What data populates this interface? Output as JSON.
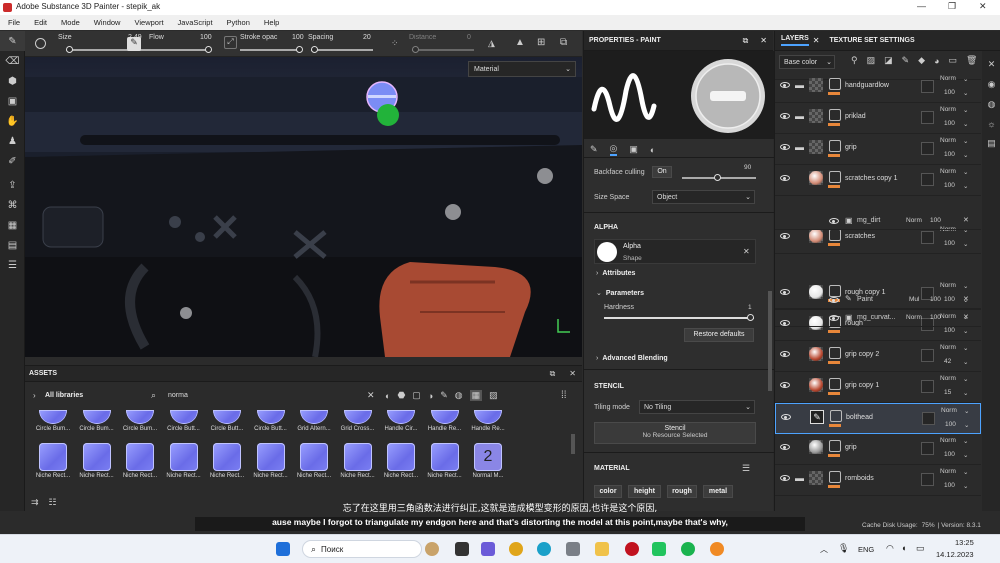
{
  "window": {
    "title": "Adobe Substance 3D Painter - stepik_ak"
  },
  "menu": [
    "File",
    "Edit",
    "Mode",
    "Window",
    "Viewport",
    "JavaScript",
    "Python",
    "Help"
  ],
  "toolbar": {
    "size": {
      "label": "Size",
      "value": "2.49"
    },
    "flow": {
      "label": "Flow",
      "value": "100"
    },
    "stroke": {
      "label": "Stroke opac",
      "value": "100"
    },
    "spacing": {
      "label": "Spacing",
      "value": "20"
    },
    "distance": {
      "label": "Distance",
      "value": "0"
    }
  },
  "viewport": {
    "mode_select": "Material"
  },
  "assets": {
    "title": "ASSETS",
    "library": "All libraries",
    "search": "norma",
    "row1": [
      "Circle Bum...",
      "Circle Bum...",
      "Circle Bum...",
      "Circle Butt...",
      "Circle Butt...",
      "Circle Butt...",
      "Grid Altern...",
      "Grid Cross...",
      "Handle Cir...",
      "Handle Re...",
      "Handle Re..."
    ],
    "row2": [
      "Niche Rect...",
      "Niche Rect...",
      "Niche Rect...",
      "Niche Rect...",
      "Niche Rect...",
      "Niche Rect...",
      "Niche Rect...",
      "Niche Rect...",
      "Niche Rect...",
      "Niche Rect...",
      "Normal M..."
    ]
  },
  "properties": {
    "title": "PROPERTIES - PAINT",
    "backface_label": "Backface culling",
    "backface_value": "On",
    "backface_num": "90",
    "size_space_label": "Size Space",
    "size_space_value": "Object",
    "alpha_section": "ALPHA",
    "alpha_name": "Alpha",
    "alpha_sub": "Shape",
    "attributes": "Attributes",
    "parameters": "Parameters",
    "hardness_label": "Hardness",
    "hardness_value": "1",
    "restore": "Restore defaults",
    "advanced": "Advanced Blending",
    "stencil_section": "STENCIL",
    "tiling_label": "Tiling mode",
    "tiling_value": "No Tiling",
    "stencil_btn": "Stencil",
    "stencil_sub": "No Resource Selected",
    "material_section": "MATERIAL",
    "channels": [
      "color",
      "height",
      "rough",
      "metal"
    ]
  },
  "layers": {
    "tab1": "LAYERS",
    "tab2": "TEXTURE SET SETTINGS",
    "channel": "Base color",
    "rows": [
      {
        "name": "handguardlow",
        "blend": "Norm",
        "opacity": "100"
      },
      {
        "name": "priklad",
        "blend": "Norm",
        "opacity": "100"
      },
      {
        "name": "grip",
        "blend": "Norm",
        "opacity": "100"
      },
      {
        "name": "scratches copy 1",
        "blend": "Norm",
        "opacity": "100"
      },
      {
        "name": "scratches",
        "blend": "Norm",
        "opacity": "100"
      },
      {
        "name": "rough copy 1",
        "blend": "Norm",
        "opacity": "100"
      },
      {
        "name": "rough",
        "blend": "Norm",
        "opacity": "100"
      },
      {
        "name": "grip copy 2",
        "blend": "Norm",
        "opacity": "42"
      },
      {
        "name": "grip copy 1",
        "blend": "Norm",
        "opacity": "15"
      },
      {
        "name": "bolthead",
        "blend": "Norm",
        "opacity": "100"
      },
      {
        "name": "grip",
        "blend": "Norm",
        "opacity": "100"
      },
      {
        "name": "romboids",
        "blend": "Norm",
        "opacity": "100"
      }
    ],
    "sub1": {
      "name": "mg_dirt",
      "blend": "Norm",
      "opacity": "100"
    },
    "sub2": {
      "name": "Paint",
      "blend": "Mul",
      "opacity": "100"
    },
    "sub3": {
      "name": "mg_curvat...",
      "blend": "Norm",
      "opacity": "100"
    }
  },
  "status": {
    "cache": "Cache Disk Usage:",
    "cache_val": "75%",
    "version": "| Version: 8.3.1"
  },
  "subtitle": {
    "zh": "忘了在这里用三角函数法进行纠正,这就是造成模型变形的原因,也许是这个原因,",
    "en": "ause maybe I forgot to triangulate my endgon here and that's distorting the model at this point,maybe that's why,"
  },
  "taskbar": {
    "search": "Поиск",
    "lang": "ENG",
    "time": "13:25",
    "date": "14.12.2023"
  }
}
